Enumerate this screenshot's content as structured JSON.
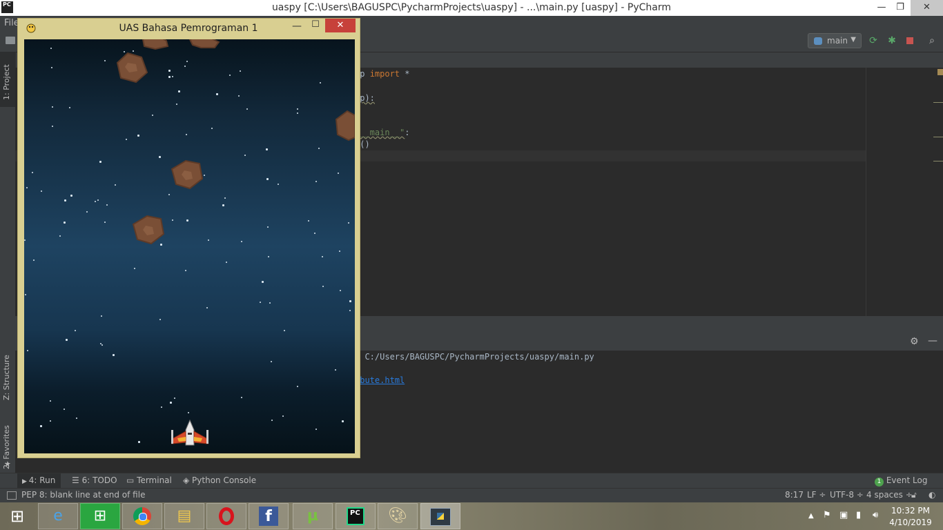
{
  "ide": {
    "window_title": "uaspy [C:\\Users\\BAGUSPC\\PycharmProjects\\uaspy] - ...\\main.py [uaspy] - PyCharm",
    "logo_text": "PC",
    "menu_file": "File",
    "run_config": "main",
    "left_tabs": {
      "project": "1: Project",
      "structure": "Z: Structure",
      "favorites": "2: Favorites"
    },
    "code_lines": {
      "line1_text": "op ",
      "line1_kw": "import",
      "line1_rest": " *",
      "line3": "pp):",
      "line6_str": "\"__main__\"",
      "line6_rest": ":",
      "line7": "p()"
    },
    "run_output": {
      "path_line": "e C:/Users/BAGUSPC/PycharmProjects/uaspy/main.py",
      "link_text": "ibute.html"
    },
    "bottom_tabs": [
      "4: Run",
      "6: TODO",
      "Terminal",
      "Python Console"
    ],
    "event_log": "Event Log",
    "event_log_count": "1",
    "status": {
      "message": "PEP 8: blank line at end of file",
      "position": "8:17",
      "line_sep": "LF ÷",
      "encoding": "UTF-8 ÷",
      "indent": "4 spaces ÷"
    }
  },
  "game": {
    "title": "UAS Bahasa Pemrograman 1",
    "close_glyph": "✕",
    "min_glyph": "—",
    "max_glyph": "☐"
  },
  "taskbar": {
    "apps": [
      "internet-explorer",
      "windows-store",
      "chrome",
      "file-explorer",
      "opera",
      "facebook",
      "utorrent",
      "pycharm",
      "paint",
      "python"
    ],
    "time": "10:32 PM",
    "date": "4/10/2019"
  },
  "colors": {
    "ide_bg": "#2b2b2b",
    "ide_panel": "#3c3f41",
    "keyword": "#cc7832",
    "string": "#6a8759",
    "link": "#287bde",
    "game_frame": "#d9cf91",
    "game_close": "#c7413a"
  }
}
